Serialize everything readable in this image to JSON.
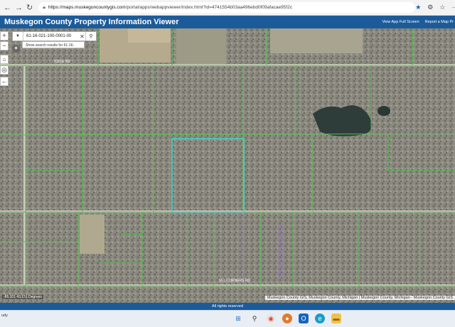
{
  "browser": {
    "url_host": "https://maps.muskegoncountygis.com",
    "url_path": "/portal/apps/webappviewer/index.html?id=4741554b03aa496ebd0f09afacae95f2c",
    "icons": [
      "back-icon",
      "forward-icon",
      "reload-icon",
      "lock-icon",
      "star-icon",
      "extensions-icon",
      "favorites-icon",
      "more-icon"
    ]
  },
  "header": {
    "title": "Muskegon County Property Information Viewer",
    "link_fullscreen": "View App Full Screen",
    "link_report": "Report a Map Pr"
  },
  "search": {
    "value": "61-16-021-100-0001-00",
    "suggestion": "Show search results for 61-16-"
  },
  "map_tools": {
    "zoom_in": "+",
    "zoom_out": "−",
    "home": "⌂",
    "locate": "◎",
    "back": "←",
    "basemap": "◈"
  },
  "map_labels": {
    "road_top": "ICKLE RD",
    "road_bottom": "ULL CORNERS RD"
  },
  "coords": "-86.101 43.151 Degrees",
  "attribution": "Muskegon County GIS, Muskegon County, Michigan | Muskegon County, Michigan - Muskegon County GIS",
  "footer": "All rights reserved",
  "taskbar": {
    "weather_line": "udy",
    "icons": [
      "windows-start-icon",
      "search-icon",
      "chrome-icon",
      "firefox-icon",
      "outlook-icon",
      "edge-icon",
      "file-explorer-icon"
    ]
  },
  "colors": {
    "header_bg": "#1c5b9a",
    "parcel_line": "#4fc24a",
    "selected_parcel": "#3fd6c8",
    "hatch": "#9a6fd0"
  }
}
